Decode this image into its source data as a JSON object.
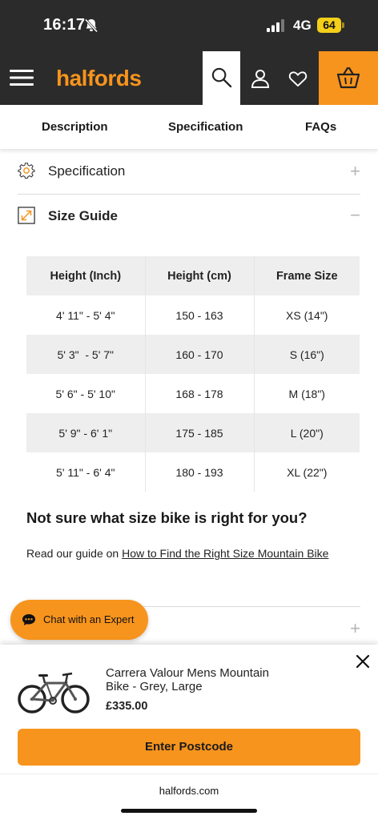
{
  "status_bar": {
    "time": "16:17",
    "network": "4G",
    "battery": "64",
    "icons": [
      "bell-muted-icon",
      "signal-icon",
      "battery-icon"
    ]
  },
  "header": {
    "logo": "halfords",
    "brand_color": "#f7941d",
    "background_color": "#2b2b2b",
    "icons": [
      "menu-icon",
      "search-icon",
      "user-icon",
      "heart-icon",
      "basket-icon"
    ]
  },
  "tabs": [
    {
      "label": "Description"
    },
    {
      "label": "Specification"
    },
    {
      "label": "FAQs"
    }
  ],
  "accordion": {
    "specification": {
      "label": "Specification",
      "icon": "gear-icon",
      "state": "+"
    },
    "size_guide": {
      "label": "Size Guide",
      "icon": "expand-icon",
      "state": "−"
    },
    "collapsed_next": {
      "state": "+"
    }
  },
  "size_table": {
    "headers": [
      "Height (Inch)",
      "Height (cm)",
      "Frame Size"
    ],
    "rows": [
      [
        "4' 11\" - 5' 4\"",
        "150 - 163",
        "XS (14\")"
      ],
      [
        "5' 3\"  - 5' 7\"",
        "160 - 170",
        "S (16\")"
      ],
      [
        "5' 6\" - 5' 10\"",
        "168 - 178",
        "M (18\")"
      ],
      [
        "5' 9\" - 6' 1\"",
        "175 - 185",
        "L (20\")"
      ],
      [
        "5' 11\" - 6' 4\"",
        "180 - 193",
        "XL (22\")"
      ]
    ]
  },
  "help": {
    "title": "Not sure what size bike is right for you?",
    "prefix": "Read our guide on ",
    "link": "How to Find the Right Size Mountain Bike"
  },
  "chat": {
    "label": "Chat with an Expert",
    "icon": "chat-bubble-icon"
  },
  "product_sheet": {
    "name": "Carrera Valour Mens Mountain Bike - Grey, Large",
    "price": "£335.00",
    "cta": "Enter Postcode",
    "domain": "halfords.com",
    "icons": [
      "close-icon",
      "bike-image"
    ]
  }
}
